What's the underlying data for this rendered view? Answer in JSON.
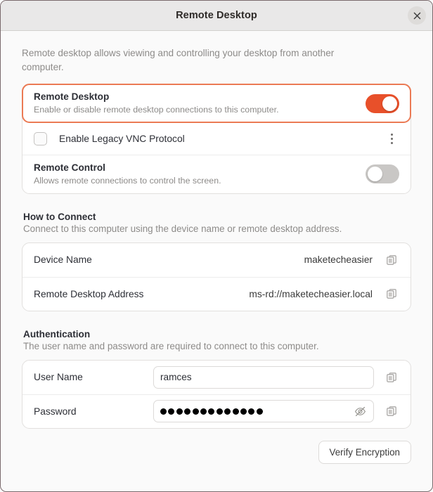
{
  "window": {
    "title": "Remote Desktop",
    "close_icon": "close-icon"
  },
  "intro": "Remote desktop allows viewing and controlling your desktop from another computer.",
  "settings_card": {
    "remote_desktop": {
      "title": "Remote Desktop",
      "subtitle": "Enable or disable remote desktop connections to this computer.",
      "toggle_state": "on",
      "accent_color": "#e8502a",
      "focused": true
    },
    "legacy_vnc": {
      "label": "Enable Legacy VNC Protocol",
      "checked": false,
      "menu_icon": "more-vertical-icon"
    },
    "remote_control": {
      "title": "Remote Control",
      "subtitle": "Allows remote connections to control the screen.",
      "toggle_state": "off"
    }
  },
  "how_to_connect": {
    "heading": "How to Connect",
    "subheading": "Connect to this computer using the device name or remote desktop address.",
    "rows": [
      {
        "label": "Device Name",
        "value": "maketecheasier",
        "copy_icon": "copy-icon"
      },
      {
        "label": "Remote Desktop Address",
        "value": "ms-rd://maketecheasier.local",
        "copy_icon": "copy-icon"
      }
    ]
  },
  "authentication": {
    "heading": "Authentication",
    "subheading": "The user name and password are required to connect to this computer.",
    "username": {
      "label": "User Name",
      "value": "ramces",
      "copy_icon": "copy-icon"
    },
    "password": {
      "label": "Password",
      "masked_length": 13,
      "visibility_icon": "eye-slash-icon",
      "copy_icon": "copy-icon"
    },
    "verify_button": "Verify Encryption"
  }
}
